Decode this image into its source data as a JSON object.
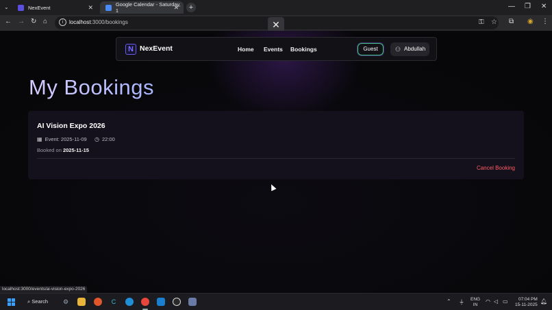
{
  "browser": {
    "tabs": [
      {
        "label": "NexEvent",
        "active": true
      },
      {
        "label": "Google Calendar - Saturday, 1",
        "active": false
      }
    ],
    "url_host": "localhost",
    "url_path": ":3000/bookings",
    "status_url": "localhost:3000/events/ai-vision-expo-2026"
  },
  "navbar": {
    "logo_letter": "N",
    "brand": "NexEvent",
    "links": [
      "Home",
      "Events",
      "Bookings"
    ],
    "guest_label": "Guest",
    "user_label": "Abdullah"
  },
  "page": {
    "title": "My Bookings"
  },
  "bookings": [
    {
      "title": "AI Vision Expo 2026",
      "event_date": "Event: 2025-11-09",
      "event_time": "22:00",
      "booked_prefix": "Booked on",
      "booked_date": "2025-11-15",
      "cancel_label": "Cancel Booking"
    }
  ],
  "taskbar": {
    "search_label": "Search",
    "lang_line1": "ENG",
    "lang_line2": "IN",
    "time": "07:04 PM",
    "date": "15-11-2025"
  },
  "colors": {
    "accent": "#7b6cff",
    "danger": "#ff5b67",
    "guest_border": "#3fbf7f"
  }
}
